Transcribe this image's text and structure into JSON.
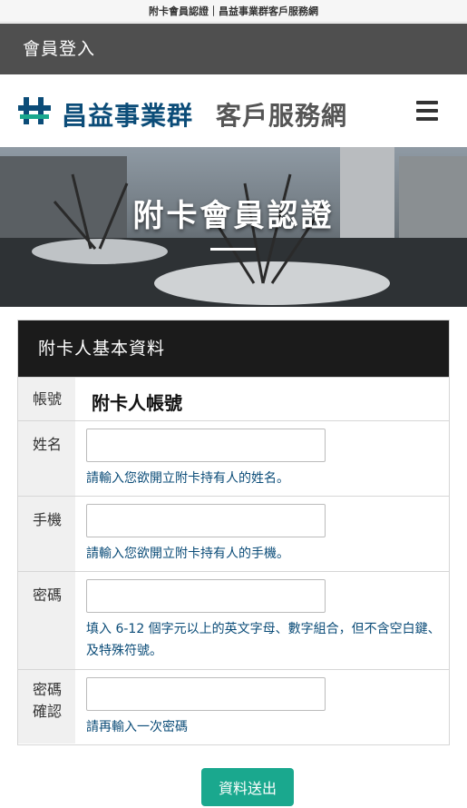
{
  "topbar": {
    "text": "附卡會員認證｜昌益事業群客戶服務網"
  },
  "login_bar": {
    "label": "會員登入"
  },
  "header": {
    "brand": "昌益事業群",
    "subbrand": "客戶服務網",
    "brand_color": "#0b4c78"
  },
  "hero": {
    "title": "附卡會員認證"
  },
  "form": {
    "heading": "附卡人基本資料",
    "account": {
      "label": "帳號",
      "value": "附卡人帳號"
    },
    "name": {
      "label": "姓名",
      "value": "",
      "hint": "請輸入您欲開立附卡持有人的姓名。"
    },
    "mobile": {
      "label": "手機",
      "value": "",
      "hint": "請輸入您欲開立附卡持有人的手機。"
    },
    "password": {
      "label": "密碼",
      "value": "",
      "hint": "填入 6-12 個字元以上的英文字母、數字組合，但不含空白鍵、及特殊符號。"
    },
    "confirm": {
      "label_line1": "密碼",
      "label_line2": "確認",
      "value": "",
      "hint": "請再輸入一次密碼"
    }
  },
  "submit": {
    "label": "資料送出",
    "color": "#1aa88e"
  }
}
